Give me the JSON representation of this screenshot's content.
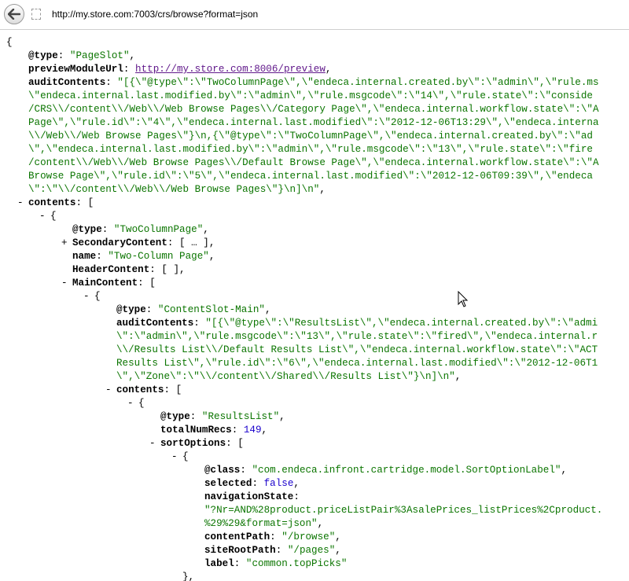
{
  "browser": {
    "url": "http://my.store.com:7003/crs/browse?format=json"
  },
  "icons": {
    "back": "back-arrow-icon",
    "page": "page-icon",
    "cursor": "mouse-pointer-icon"
  },
  "colors": {
    "string": "#0b7500",
    "number": "#1a01cc",
    "link": "#61198b"
  },
  "json_lines": [
    {
      "indent": 0,
      "prefix": "{"
    },
    {
      "indent": 1,
      "key": "@type",
      "val": "\"PageSlot\"",
      "vt": "s",
      "suffix": ","
    },
    {
      "indent": 1,
      "key": "previewModuleUrl",
      "val": "http://my.store.com:8006/preview",
      "vt": "lnk",
      "suffix": ","
    },
    {
      "indent": 1,
      "key": "auditContents",
      "val": "\"[{\\\"@type\\\":\\\"TwoColumnPage\\\",\\\"endeca.internal.created.by\\\":\\\"admin\\\",\\\"rule.ms",
      "vt": "s"
    },
    {
      "indent": 1,
      "val": "\\\"endeca.internal.last.modified.by\\\":\\\"admin\\\",\\\"rule.msgcode\\\":\\\"14\\\",\\\"rule.state\\\":\\\"conside",
      "vt": "s"
    },
    {
      "indent": 1,
      "val": "/CRS\\\\/content\\\\/Web\\\\/Web Browse Pages\\\\/Category Page\\\",\\\"endeca.internal.workflow.state\\\":\\\"A",
      "vt": "s"
    },
    {
      "indent": 1,
      "val": "Page\\\",\\\"rule.id\\\":\\\"4\\\",\\\"endeca.internal.last.modified\\\":\\\"2012-12-06T13:29\\\",\\\"endeca.interna",
      "vt": "s"
    },
    {
      "indent": 1,
      "val": "\\\\/Web\\\\/Web Browse Pages\\\"}\\n,{\\\"@type\\\":\\\"TwoColumnPage\\\",\\\"endeca.internal.created.by\\\":\\\"ad",
      "vt": "s"
    },
    {
      "indent": 1,
      "val": "\\\",\\\"endeca.internal.last.modified.by\\\":\\\"admin\\\",\\\"rule.msgcode\\\":\\\"13\\\",\\\"rule.state\\\":\\\"fire",
      "vt": "s"
    },
    {
      "indent": 1,
      "val": "/content\\\\/Web\\\\/Web Browse Pages\\\\/Default Browse Page\\\",\\\"endeca.internal.workflow.state\\\":\\\"A",
      "vt": "s"
    },
    {
      "indent": 1,
      "val": "Browse Page\\\",\\\"rule.id\\\":\\\"5\\\",\\\"endeca.internal.last.modified\\\":\\\"2012-12-06T09:39\\\",\\\"endeca",
      "vt": "s"
    },
    {
      "indent": 1,
      "val": "\\\":\\\"\\\\/content\\\\/Web\\\\/Web Browse Pages\\\"}\\n]\\n\"",
      "vt": "s",
      "suffix": ","
    },
    {
      "indent": 1,
      "toggle": "-",
      "key": "contents",
      "suffix": "["
    },
    {
      "indent": 2,
      "toggle": "-",
      "prefix": "{"
    },
    {
      "indent": 3,
      "key": "@type",
      "val": "\"TwoColumnPage\"",
      "vt": "s",
      "suffix": ","
    },
    {
      "indent": 3,
      "toggle": "+",
      "key": "SecondaryContent",
      "suffix": "[ … ],"
    },
    {
      "indent": 3,
      "key": "name",
      "val": "\"Two-Column Page\"",
      "vt": "s",
      "suffix": ","
    },
    {
      "indent": 3,
      "key": "HeaderContent",
      "suffix": "[ ],"
    },
    {
      "indent": 3,
      "toggle": "-",
      "key": "MainContent",
      "suffix": "["
    },
    {
      "indent": 4,
      "toggle": "-",
      "prefix": "{"
    },
    {
      "indent": 5,
      "key": "@type",
      "val": "\"ContentSlot-Main\"",
      "vt": "s",
      "suffix": ","
    },
    {
      "indent": 5,
      "key": "auditContents",
      "val": "\"[{\\\"@type\\\":\\\"ResultsList\\\",\\\"endeca.internal.created.by\\\":\\\"admi",
      "vt": "s"
    },
    {
      "indent": 5,
      "val": "\\\":\\\"admin\\\",\\\"rule.msgcode\\\":\\\"13\\\",\\\"rule.state\\\":\\\"fired\\\",\\\"endeca.internal.r",
      "vt": "s"
    },
    {
      "indent": 5,
      "val": "\\\\/Results List\\\\/Default Results List\\\",\\\"endeca.internal.workflow.state\\\":\\\"ACT",
      "vt": "s"
    },
    {
      "indent": 5,
      "val": "Results List\\\",\\\"rule.id\\\":\\\"6\\\",\\\"endeca.internal.last.modified\\\":\\\"2012-12-06T1",
      "vt": "s"
    },
    {
      "indent": 5,
      "val": "\\\",\\\"Zone\\\":\\\"\\\\/content\\\\/Shared\\\\/Results List\\\"}\\n]\\n\"",
      "vt": "s",
      "suffix": ","
    },
    {
      "indent": 5,
      "toggle": "-",
      "key": "contents",
      "suffix": "["
    },
    {
      "indent": 6,
      "toggle": "-",
      "prefix": "{"
    },
    {
      "indent": 7,
      "key": "@type",
      "val": "\"ResultsList\"",
      "vt": "s",
      "suffix": ","
    },
    {
      "indent": 7,
      "key": "totalNumRecs",
      "val": "149",
      "vt": "n",
      "suffix": ","
    },
    {
      "indent": 7,
      "toggle": "-",
      "key": "sortOptions",
      "suffix": "["
    },
    {
      "indent": 8,
      "toggle": "-",
      "prefix": "{"
    },
    {
      "indent": 9,
      "key": "@class",
      "val": "\"com.endeca.infront.cartridge.model.SortOptionLabel\"",
      "vt": "s",
      "suffix": ","
    },
    {
      "indent": 9,
      "key": "selected",
      "val": "false",
      "vt": "b",
      "suffix": ","
    },
    {
      "indent": 9,
      "key": "navigationState"
    },
    {
      "indent": 9,
      "val": "\"?Nr=AND%28product.priceListPair%3AsalePrices_listPrices%2Cproduct.",
      "vt": "s"
    },
    {
      "indent": 9,
      "val": "%29%29&format=json\"",
      "vt": "s",
      "suffix": ","
    },
    {
      "indent": 9,
      "key": "contentPath",
      "val": "\"/browse\"",
      "vt": "s",
      "suffix": ","
    },
    {
      "indent": 9,
      "key": "siteRootPath",
      "val": "\"/pages\"",
      "vt": "s",
      "suffix": ","
    },
    {
      "indent": 9,
      "key": "label",
      "val": "\"common.topPicks\"",
      "vt": "s"
    },
    {
      "indent": 8,
      "prefix": "},"
    }
  ]
}
